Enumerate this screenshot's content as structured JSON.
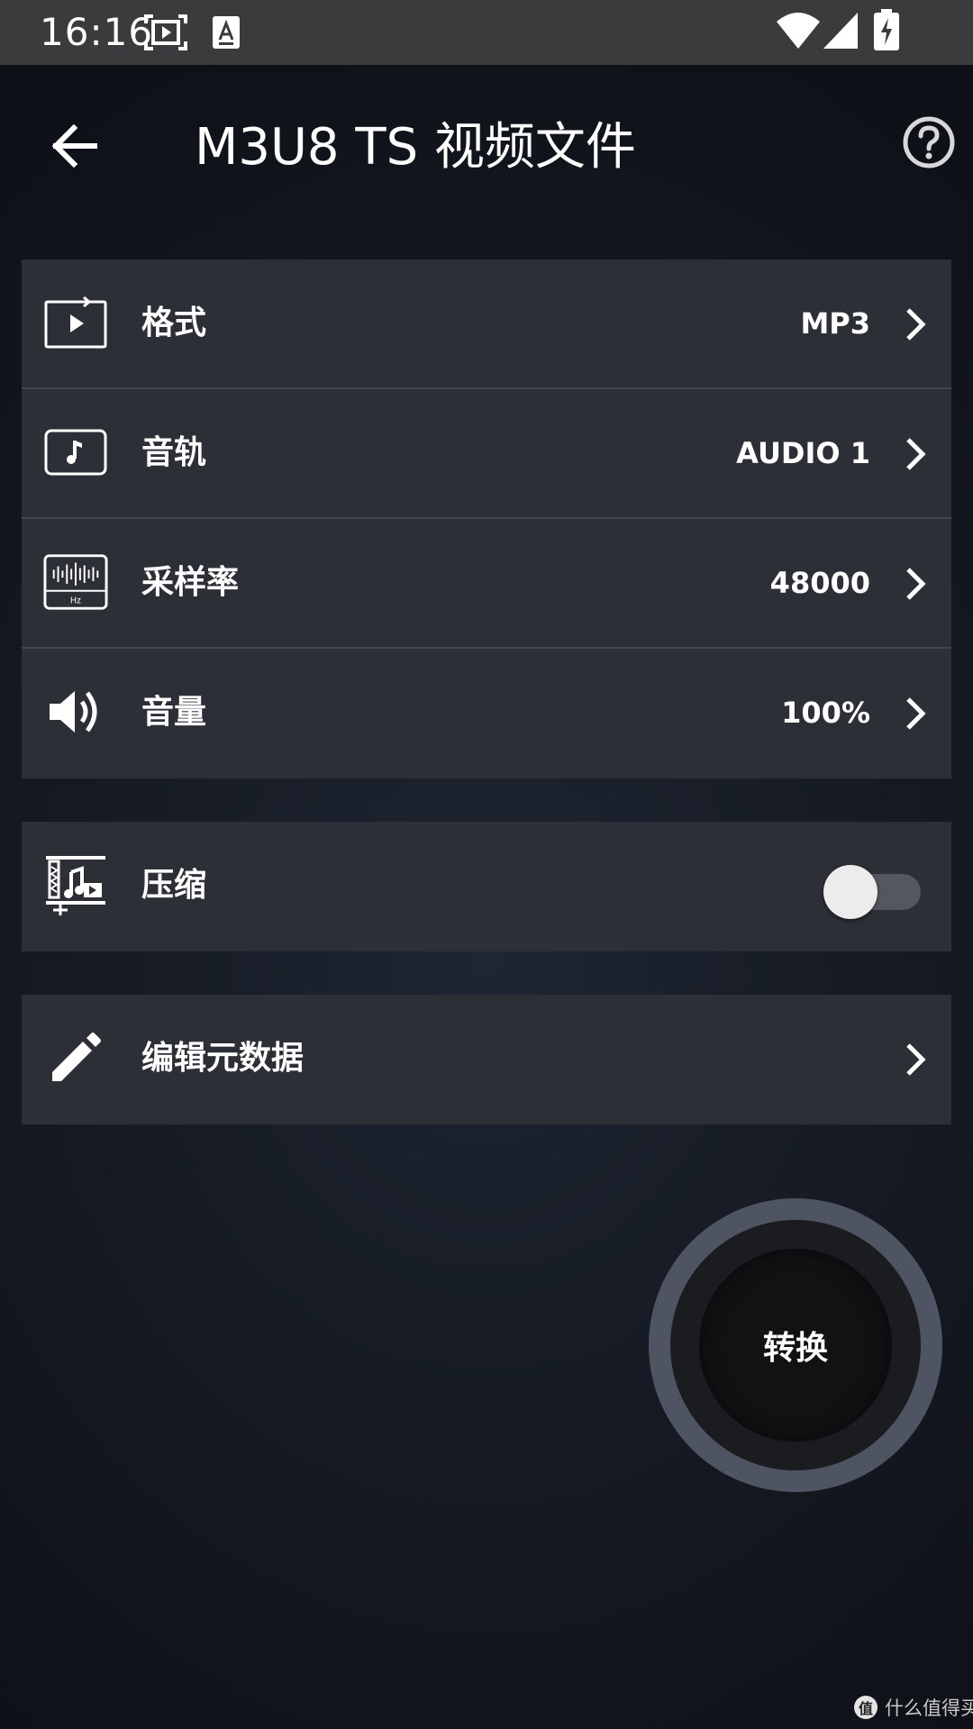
{
  "status_bar": {
    "time": "16:16",
    "icons": [
      "screen-record-icon",
      "keyboard-a-icon",
      "wifi-icon",
      "cellular-signal-icon",
      "battery-charging-icon"
    ]
  },
  "header": {
    "title": "M3U8 TS 视频文件",
    "back_icon": "arrow-back-icon",
    "help_icon": "help-circle-icon"
  },
  "settings": {
    "rows": [
      {
        "icon": "format-icon",
        "label": "格式",
        "value": "MP3"
      },
      {
        "icon": "audio-track-icon",
        "label": "音轨",
        "value": "AUDIO 1"
      },
      {
        "icon": "sample-rate-icon",
        "label": "采样率",
        "value": "48000"
      },
      {
        "icon": "volume-icon",
        "label": "音量",
        "value": "100%"
      }
    ],
    "sample_rate_unit": "Hz"
  },
  "compress": {
    "icon": "compress-icon",
    "label": "压缩",
    "enabled": false
  },
  "metadata": {
    "icon": "pencil-icon",
    "label": "编辑元数据"
  },
  "convert": {
    "label": "转换"
  },
  "watermark": {
    "badge": "值",
    "text": "什么值得买"
  },
  "colors": {
    "card_bg": "#2c2f35",
    "divider": "#43464d",
    "toggle_track": "#54575e",
    "toggle_thumb": "#ececec",
    "convert_ring": "#4e5461",
    "status_bar": "#3b3b3d"
  }
}
